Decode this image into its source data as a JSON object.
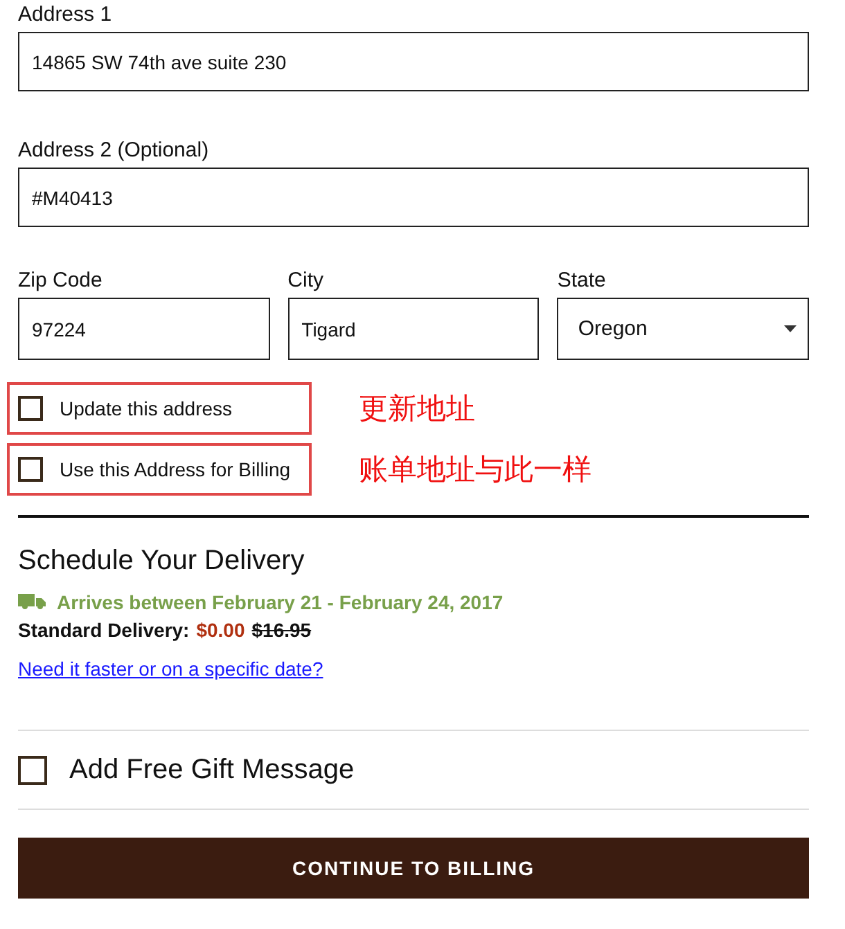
{
  "address_fields": [
    {
      "label": "Address 1",
      "value": "14865 SW 74th ave suite 230"
    },
    {
      "label": "Address 2 (Optional)",
      "value": "#M40413"
    }
  ],
  "location_fields": [
    {
      "kind": "text",
      "label": "Zip Code",
      "value": "97224"
    },
    {
      "kind": "text",
      "label": "City",
      "value": "Tigard"
    },
    {
      "kind": "select",
      "label": "State",
      "value": "Oregon"
    }
  ],
  "address_options": [
    {
      "label": "Update this address",
      "checked": false,
      "highlighted": true,
      "note": "更新地址"
    },
    {
      "label": "Use this Address for Billing",
      "checked": false,
      "highlighted": true,
      "note": "账单地址与此一样"
    }
  ],
  "delivery": {
    "title": "Schedule Your Delivery",
    "arrival": "Arrives between February 21 - February 24, 2017",
    "method_label": "Standard Delivery:",
    "price": "$0.00",
    "original_price": "$16.95",
    "link": "Need it faster or on a specific date?"
  },
  "gift_message": {
    "label": "Add Free Gift Message",
    "checked": false
  },
  "continue_button": "CONTINUE TO BILLING"
}
